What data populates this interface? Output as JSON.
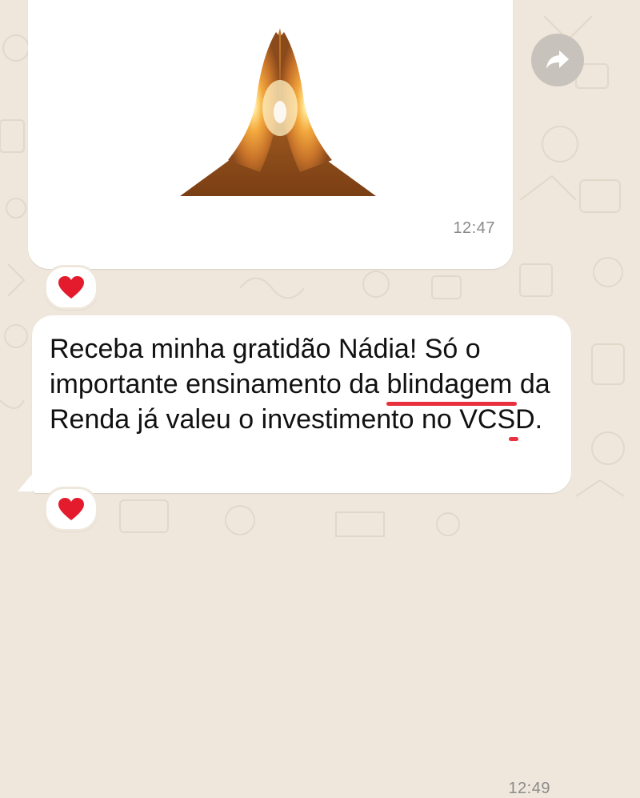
{
  "messages": [
    {
      "type": "image",
      "image_description": "praying-hands",
      "time": "12:47",
      "reaction": "heart"
    },
    {
      "type": "text",
      "text_before": "Receba minha gratidão Nádia! Só o importante ensinamento da ",
      "highlight_1": "blindagem",
      "highlight_2": "da Renda já",
      "text_after": " valeu o investimento no VCSD.",
      "time": "12:49",
      "reaction": "heart"
    }
  ],
  "colors": {
    "background": "#efe7dc",
    "bubble": "#ffffff",
    "underline": "#e8303f",
    "heart": "#e31b2d",
    "forward_button": "#c7c2bb"
  },
  "icons": {
    "forward": "forward-arrow-icon",
    "reaction": "heart-icon"
  }
}
